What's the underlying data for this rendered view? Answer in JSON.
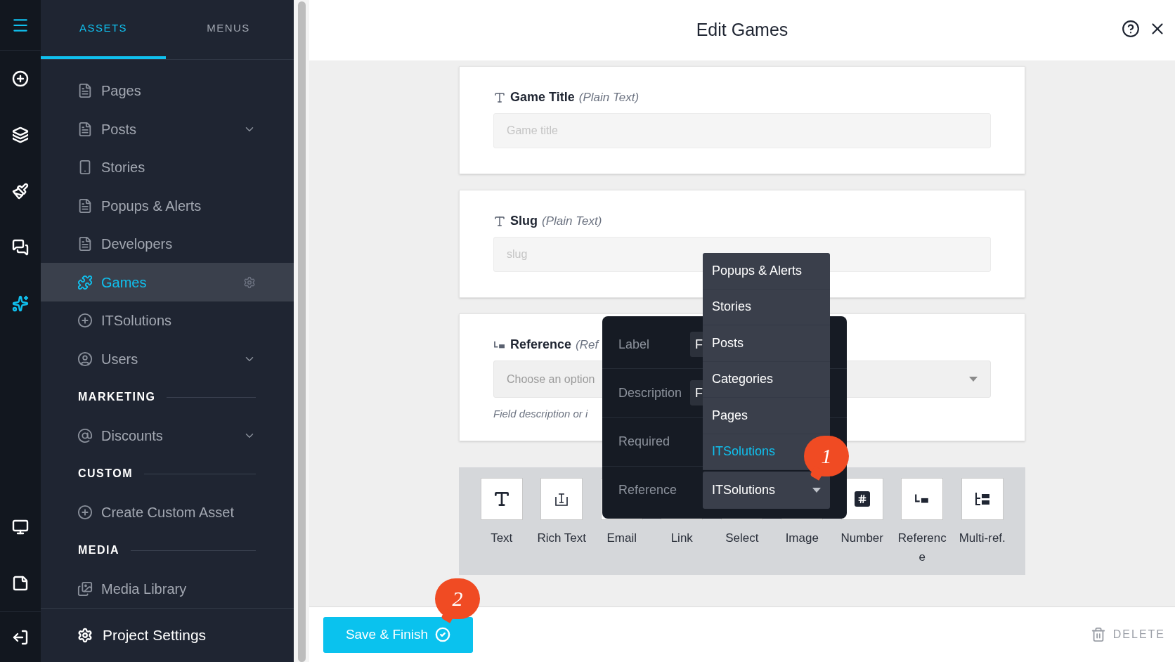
{
  "rail": [
    {
      "selected": false
    },
    {
      "selected": false
    },
    {
      "selected": false
    },
    {
      "selected": false
    },
    {
      "selected": true
    },
    {
      "selected": false
    },
    {
      "selected": false
    }
  ],
  "tabs": [
    {
      "label": "ASSETS",
      "selected": true
    },
    {
      "label": "MENUS",
      "selected": false
    }
  ],
  "sidebar": {
    "items": [
      {
        "kind": "item",
        "label": "Pages",
        "expandable": false,
        "selected": false
      },
      {
        "kind": "item",
        "label": "Posts",
        "expandable": true,
        "selected": false
      },
      {
        "kind": "item",
        "label": "Stories",
        "expandable": false,
        "selected": false
      },
      {
        "kind": "item",
        "label": "Popups & Alerts",
        "expandable": false,
        "selected": false
      },
      {
        "kind": "item",
        "label": "Developers",
        "expandable": false,
        "selected": false
      },
      {
        "kind": "item",
        "label": "Games",
        "expandable": false,
        "selected": true
      },
      {
        "kind": "item",
        "label": "ITSolutions",
        "expandable": false,
        "selected": false
      },
      {
        "kind": "item",
        "label": "Users",
        "expandable": true,
        "selected": false
      },
      {
        "kind": "section",
        "label": "MARKETING"
      },
      {
        "kind": "item",
        "label": "Discounts",
        "expandable": true,
        "selected": false
      },
      {
        "kind": "section",
        "label": "CUSTOM"
      },
      {
        "kind": "item",
        "label": "Create Custom Asset",
        "expandable": false,
        "selected": false
      },
      {
        "kind": "section",
        "label": "MEDIA"
      },
      {
        "kind": "item",
        "label": "Media Library",
        "expandable": false,
        "selected": false
      }
    ],
    "project_settings": "Project Settings"
  },
  "header": {
    "title": "Edit Games"
  },
  "fields": [
    {
      "kind": "text",
      "label": "Game Title",
      "type_label": "(Plain Text)",
      "placeholder": "Game title"
    },
    {
      "kind": "text",
      "label": "Slug",
      "type_label": "(Plain Text)",
      "placeholder": "slug"
    },
    {
      "kind": "reference",
      "label": "Reference",
      "type_label": "(Ref",
      "placeholder": "Choose an option",
      "description": "Field description or i"
    }
  ],
  "field_types": [
    {
      "label": "Text"
    },
    {
      "label": "Rich Text"
    },
    {
      "label": "Email"
    },
    {
      "label": "Link"
    },
    {
      "label": "Select"
    },
    {
      "label": "Image"
    },
    {
      "label": "Number"
    },
    {
      "label": "Reference"
    },
    {
      "label": "Multi-ref."
    }
  ],
  "popover": {
    "rows": [
      {
        "kind": "input",
        "label": "Label",
        "value": "F"
      },
      {
        "kind": "input",
        "label": "Description",
        "value": "F"
      },
      {
        "kind": "plain",
        "label": "Required"
      },
      {
        "kind": "select",
        "label": "Reference",
        "value": "ITSolutions"
      }
    ]
  },
  "dropdown": {
    "options": [
      {
        "label": "Popups & Alerts",
        "selected": false
      },
      {
        "label": "Stories",
        "selected": false
      },
      {
        "label": "Posts",
        "selected": false
      },
      {
        "label": "Categories",
        "selected": false
      },
      {
        "label": "Pages",
        "selected": false
      },
      {
        "label": "ITSolutions",
        "selected": true
      }
    ]
  },
  "badges": [
    "1",
    "2"
  ],
  "footer": {
    "save_button": "Save & Finish",
    "delete_button": "DELETE"
  }
}
